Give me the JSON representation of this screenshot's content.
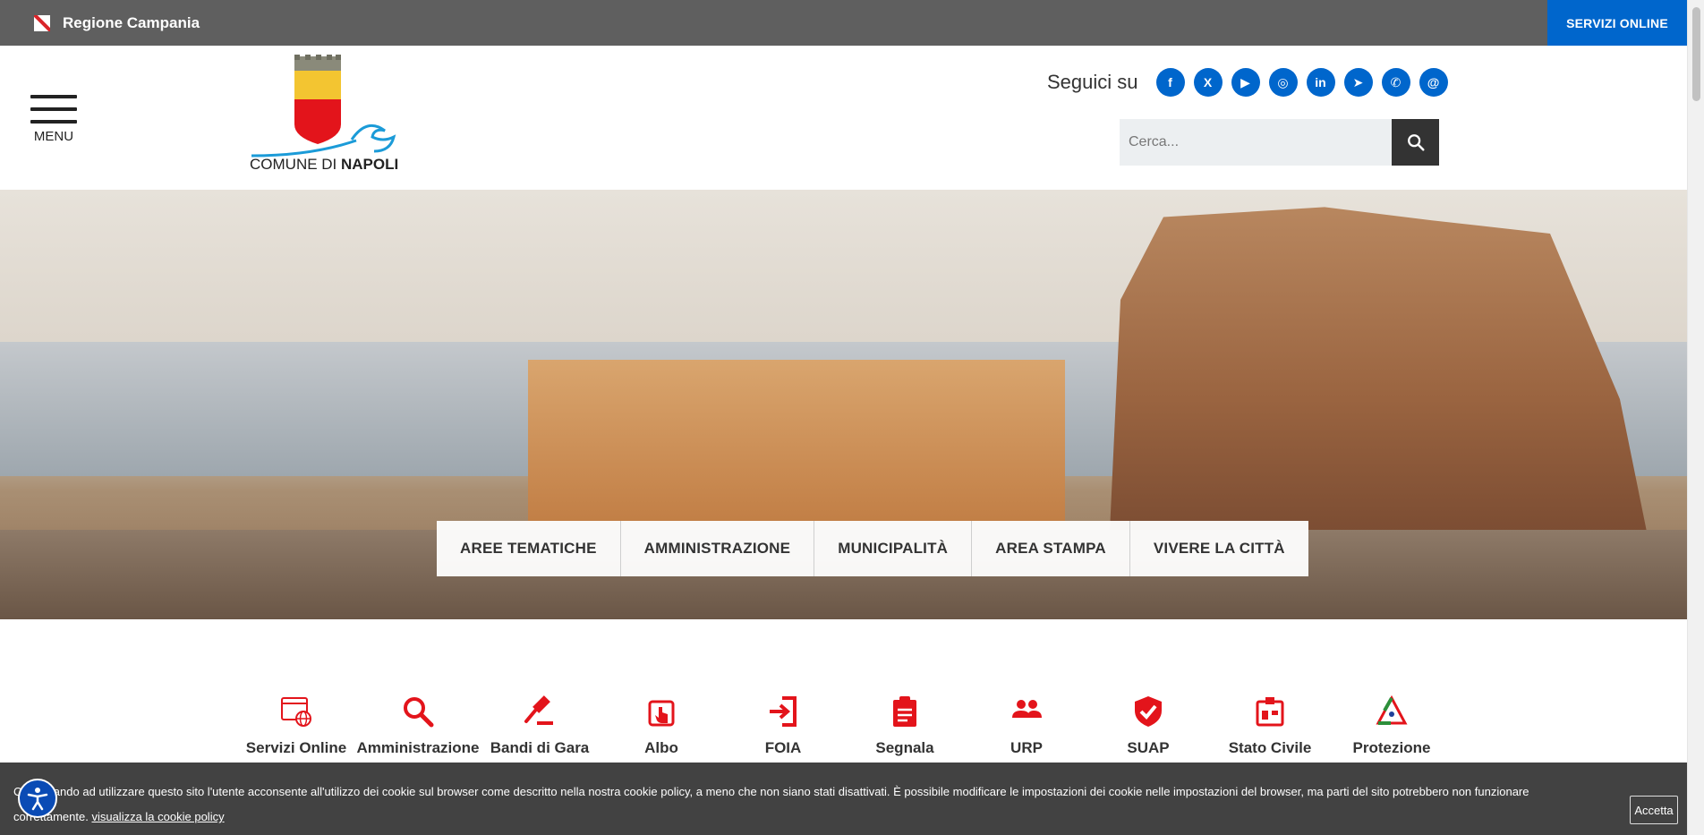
{
  "topbar": {
    "region_label": "Regione Campania",
    "servizi_label": "SERVIZI ONLINE"
  },
  "header": {
    "menu_label": "MENU",
    "logo_text_prefix": "COMUNE DI ",
    "logo_text_bold": "NAPOLI",
    "social_label": "Seguici su",
    "social_icons": [
      "facebook-icon",
      "x-icon",
      "youtube-icon",
      "instagram-icon",
      "linkedin-icon",
      "telegram-icon",
      "whatsapp-icon",
      "threads-icon"
    ],
    "search_placeholder": "Cerca..."
  },
  "hero_nav": [
    "AREE TEMATICHE",
    "AMMINISTRAZIONE",
    "MUNICIPALITÀ",
    "AREA STAMPA",
    "VIVERE LA CITTÀ"
  ],
  "services": [
    {
      "label": "Servizi Online",
      "icon": "browser-globe-icon"
    },
    {
      "label": "Amministrazione",
      "icon": "search-icon"
    },
    {
      "label": "Bandi di Gara",
      "icon": "gavel-icon"
    },
    {
      "label": "Albo",
      "icon": "touch-icon"
    },
    {
      "label": "FOIA",
      "icon": "login-icon"
    },
    {
      "label": "Segnala",
      "icon": "clipboard-icon"
    },
    {
      "label": "URP",
      "icon": "people-icon"
    },
    {
      "label": "SUAP",
      "icon": "shield-check-icon"
    },
    {
      "label": "Stato Civile",
      "icon": "registry-icon"
    },
    {
      "label": "Protezione",
      "icon": "civil-protection-icon"
    }
  ],
  "cookie": {
    "text": "Continuando ad utilizzare questo sito l'utente acconsente all'utilizzo dei cookie sul browser come descritto nella nostra cookie policy, a meno che non siano stati disattivati. È possibile modificare le impostazioni dei cookie nelle impostazioni del browser, ma parti del sito potrebbero non funzionare correttamente.",
    "link_label": "visualizza la cookie policy",
    "accept_label": "Accetta"
  },
  "colors": {
    "brand_blue": "#0066cc",
    "service_red": "#e3141b",
    "topbar_gray": "#5f5f5f"
  }
}
